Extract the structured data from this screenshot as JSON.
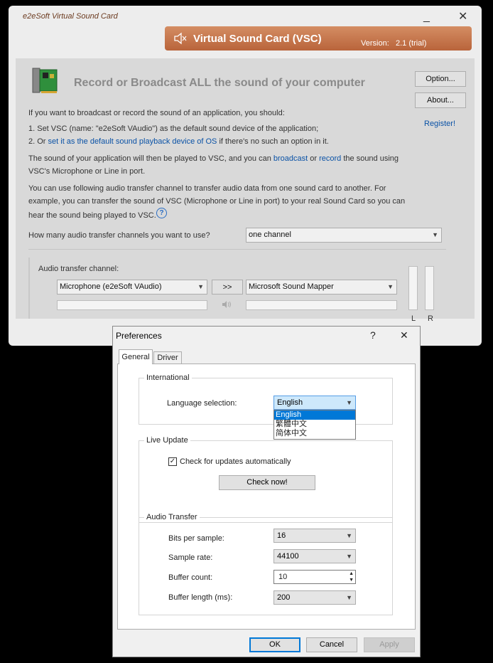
{
  "main": {
    "title": "e2eSoft Virtual Sound Card",
    "minimize": "_",
    "close": "✕",
    "banner": {
      "title": "Virtual Sound Card (VSC)",
      "version_label": "Version:",
      "version_value": "2.1 (trial)",
      "icon": "speaker-icon"
    },
    "headline": "Record or Broadcast ALL the sound of your computer",
    "buttons": {
      "option": "Option...",
      "about": "About...",
      "register": "Register!"
    },
    "intro": "If you want to broadcast or record the sound of an application, you should:",
    "step1": "1. Set VSC (name: \"e2eSoft VAudio\") as the default sound device of the application;",
    "step2_prefix": "2. Or ",
    "step2_link": "set it as the default sound playback device of OS",
    "step2_suffix": " if there's no such an option in it.",
    "para2_a": "The sound of your application will then be played to VSC, and you can ",
    "para2_broadcast": "broadcast",
    "para2_or": " or ",
    "para2_record": "record",
    "para2_b": " the sound using",
    "para2_line2": "VSC's Microphone or Line in port.",
    "para3_line1": "You can use following audio transfer channel to transfer audio data from one sound card to another. For",
    "para3_line2": "example, you can transfer the sound of VSC (Microphone or Line in port) to your real Sound Card so you can",
    "para3_line3": "hear the sound being played to VSC.",
    "help_icon": "?",
    "channels_question": "How many audio transfer channels you want to use?",
    "channels_value": "one channel",
    "transfer": {
      "label": "Audio transfer channel:",
      "source": "Microphone (e2eSoft VAudio)",
      "arrow_button": ">>",
      "target": "Microsoft Sound Mapper",
      "left_label": "L",
      "right_label": "R"
    }
  },
  "dialog": {
    "title": "Preferences",
    "help": "?",
    "close": "✕",
    "tabs": [
      "General",
      "Driver"
    ],
    "international": {
      "legend": "International",
      "language_label": "Language selection:",
      "language_value": "English",
      "options": [
        "English",
        "繁體中文",
        "简体中文"
      ]
    },
    "live_update": {
      "legend": "Live Update",
      "checkbox_label": "Check for updates automatically",
      "checked": true,
      "check_now": "Check now!"
    },
    "audio_transfer": {
      "legend": "Audio Transfer",
      "bits_label": "Bits per sample:",
      "bits_value": "16",
      "rate_label": "Sample rate:",
      "rate_value": "44100",
      "count_label": "Buffer count:",
      "count_value": "10",
      "length_label": "Buffer length (ms):",
      "length_value": "200"
    },
    "buttons": {
      "ok": "OK",
      "cancel": "Cancel",
      "apply": "Apply"
    }
  }
}
